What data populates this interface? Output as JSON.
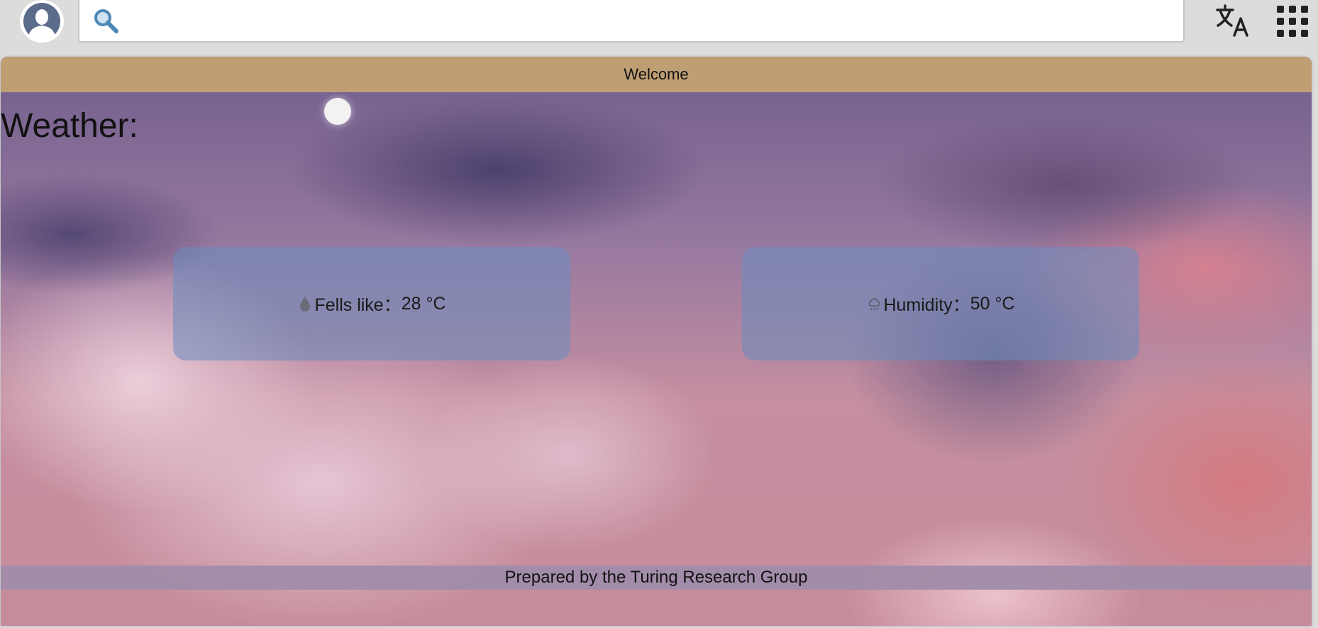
{
  "topbar": {
    "search": {
      "value": "",
      "placeholder": ""
    },
    "icons": {
      "avatar": "user-avatar-icon",
      "search": "search-icon",
      "translate": "translate-icon",
      "apps": "apps-grid-icon"
    }
  },
  "page": {
    "header": {
      "title": "Welcome"
    },
    "heading": "Weather:",
    "cards": [
      {
        "icon": "water-drop-icon",
        "label": "Fells like：",
        "value": "28 °C"
      },
      {
        "icon": "cloud-icon",
        "label": "Humidity：",
        "value": "50 °C"
      }
    ],
    "footer": {
      "text": "Prepared by the Turing Research Group"
    }
  },
  "colors": {
    "header_bg": "#c09e73",
    "card_bg": "rgba(105,140,190,0.55)",
    "footer_bg": "#a08caa"
  }
}
